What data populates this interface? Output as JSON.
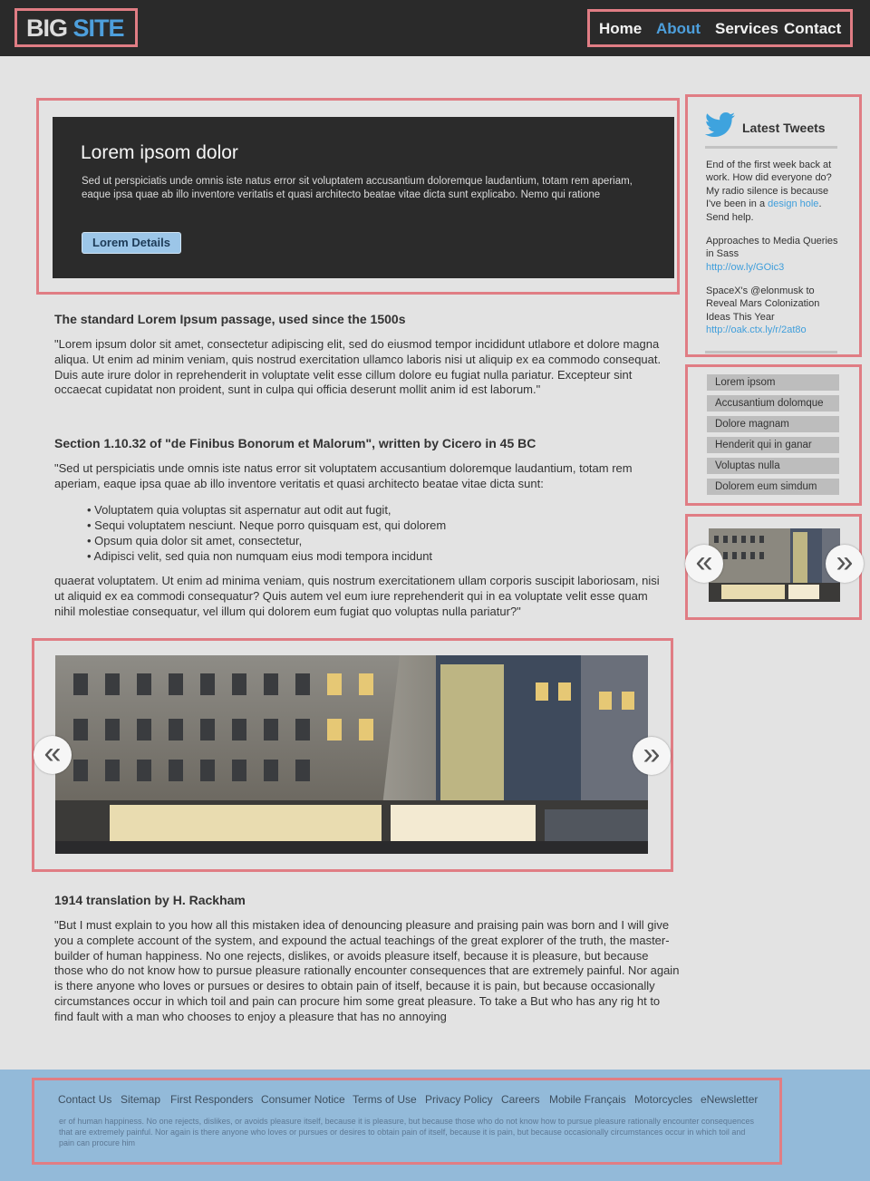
{
  "header": {
    "logo_part1": "BIG",
    "logo_part2": "SITE",
    "nav": [
      "Home",
      "About",
      "Services",
      "Contact"
    ],
    "active_nav": "About",
    "accent_color": "#4d9fdc"
  },
  "hero": {
    "title": "Lorem ipsom dolor",
    "text": "Sed ut perspiciatis unde omnis iste natus error sit voluptatem accusantium doloremque laudantium, totam rem aperiam, eaque ipsa quae ab illo inventore veritatis et quasi architecto beatae vitae dicta sunt explicabo. Nemo qui ratione",
    "button_label": "Lorem Details"
  },
  "main": {
    "heading1": "The standard Lorem Ipsum passage, used since the 1500s",
    "para1": "\"Lorem ipsum dolor sit amet, consectetur adipiscing elit, sed do eiusmod tempor incididunt utlabore et dolore magna aliqua. Ut enim ad minim veniam, quis nostrud exercitation ullamco laboris nisi ut aliquip ex ea commodo consequat. Duis aute irure dolor in reprehenderit in voluptate velit esse cillum dolore eu fugiat nulla pariatur. Excepteur sint occaecat cupidatat non proident, sunt in culpa qui officia deserunt mollit anim id est laborum.\"",
    "heading2": "Section 1.10.32 of \"de Finibus Bonorum et Malorum\", written by Cicero in 45 BC",
    "para2": "\"Sed ut perspiciatis unde omnis iste natus error sit voluptatem accusantium doloremque laudantium, totam rem aperiam, eaque ipsa quae ab illo inventore veritatis et quasi architecto beatae vitae dicta sunt:",
    "bullets": [
      "Voluptatem quia voluptas sit aspernatur aut odit aut fugit,",
      "Sequi voluptatem nesciunt. Neque porro quisquam est, qui dolorem",
      "Opsum quia dolor sit amet, consectetur,",
      "Adipisci velit, sed quia non numquam eius modi tempora incidunt"
    ],
    "para3": "quaerat voluptatem. Ut enim ad minima veniam, quis nostrum exercitationem ullam corporis suscipit laboriosam, nisi ut aliquid ex ea commodi consequatur? Quis autem vel eum iure reprehenderit qui in ea voluptate velit esse quam nihil molestiae consequatur, vel illum qui dolorem eum fugiat quo voluptas nulla pariatur?\"",
    "heading3": "1914 translation by H. Rackham",
    "para4": "\"But I must explain to you how all this mistaken idea of denouncing pleasure and praising pain was born and I will give you a complete account of the system, and expound the actual teachings of the great explorer of the truth, the master-builder of human happiness. No one rejects, dislikes, or avoids pleasure itself, because it is pleasure, but because those who do not know how to pursue pleasure rationally encounter consequences that are extremely painful. Nor again is there anyone who loves or pursues or desires to obtain pain of itself, because it is pain, but because occasionally circumstances occur in which toil and pain can procure him some great pleasure. To take a But who has any rig ht to find fault with a man who chooses to enjoy a pleasure that has no annoying",
    "slider_prev": "«",
    "slider_next": "»"
  },
  "sidebar": {
    "tweets_title": "Latest Tweets",
    "tweet1_text": "End of the first week back at work. How did everyone do? My radio silence is because I've been in a ",
    "tweet1_link": "design hole",
    "tweet1_end": ". Send help.",
    "tweet2_text": "Approaches to Media Queries in Sass",
    "tweet2_link": "http://ow.ly/GOic3",
    "tweet3_text": "SpaceX's @elonmusk to Reveal Mars Colonization Ideas This Year",
    "tweet3_link": "http://oak.ctx.ly/r/2at8o",
    "list": [
      "Lorem ipsom",
      "Accusantium dolomque",
      "Dolore magnam",
      "Henderit qui in ganar",
      "Voluptas nulla",
      "Dolorem eum simdum"
    ],
    "mini_prev": "«",
    "mini_next": "»"
  },
  "footer": {
    "links": [
      "Contact Us",
      "Sitemap",
      "First Responders",
      "Consumer Notice",
      "Terms of Use",
      "Privacy Policy",
      "Careers",
      "Mobile Français",
      "Motorcycles",
      "eNewsletter"
    ],
    "text": "er of human happiness. No one rejects, dislikes, or avoids pleasure itself, because it is pleasure, but because those who do not know how to pursue pleasure rationally encounter consequences that are extremely painful. Nor again is there anyone who loves or pursues or desires to obtain pain of itself, because it is pain, but because occasionally circumstances occur in which toil and pain can procure him"
  },
  "colors": {
    "header_bg": "#2a2a2a",
    "page_bg": "#e3e3e3",
    "footer_bg": "#93bad9",
    "highlight_border": "#e07d84",
    "link": "#3f9edb"
  }
}
